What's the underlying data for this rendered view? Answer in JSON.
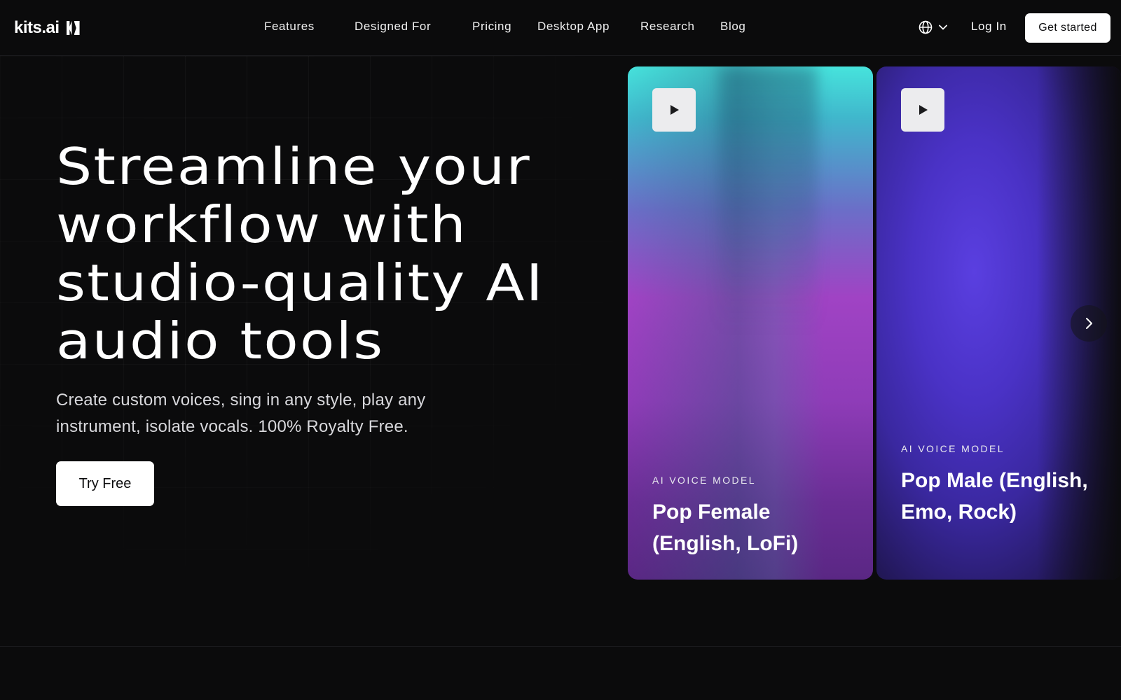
{
  "header": {
    "logo_text": "kits.ai",
    "nav": [
      {
        "label": "Features",
        "id": "features"
      },
      {
        "label": "Designed For",
        "id": "designed-for"
      },
      {
        "label": "Pricing",
        "id": "pricing"
      },
      {
        "label": "Desktop App",
        "id": "desktop-app"
      },
      {
        "label": "Research",
        "id": "research"
      },
      {
        "label": "Blog",
        "id": "blog"
      }
    ],
    "language_icon": "globe-icon",
    "login_label": "Log In",
    "cta_label": "Get started"
  },
  "hero": {
    "title": "Streamline your workflow with studio-quality AI audio tools",
    "subtitle": "Create custom voices, sing in any style, play any instrument, isolate vocals. 100% Royalty Free.",
    "cta_label": "Try Free"
  },
  "carousel": {
    "cards": [
      {
        "kicker": "AI VOICE MODEL",
        "title": "Pop Female (English, LoFi)"
      },
      {
        "kicker": "AI VOICE MODEL",
        "title": "Pop Male (English, Emo, Rock)"
      }
    ]
  },
  "colors": {
    "background": "#0b0b0c",
    "card1_top": "#46e3dc",
    "card1_mid": "#a043c4",
    "card2_main": "#4a32c6"
  }
}
